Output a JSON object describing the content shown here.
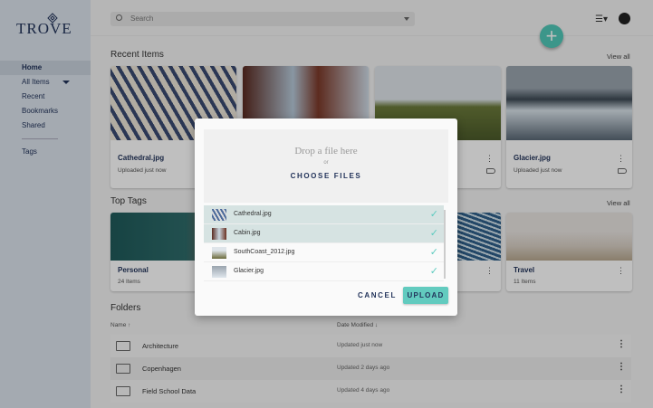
{
  "app": {
    "logo": "TROVE"
  },
  "sidebar": {
    "items": [
      {
        "label": "Home",
        "active": true
      },
      {
        "label": "All Items"
      },
      {
        "label": "Recent"
      },
      {
        "label": "Bookmarks"
      },
      {
        "label": "Shared"
      },
      {
        "label": "Tags"
      }
    ]
  },
  "topbar": {
    "search_placeholder": "Search",
    "icons": [
      "search-icon",
      "list-view-icon",
      "account-icon",
      "add-icon"
    ]
  },
  "recent": {
    "title": "Recent Items",
    "view_all": "View all",
    "items": [
      {
        "title": "Cathedral.jpg",
        "subtitle": "Uploaded just now"
      },
      {
        "title": "",
        "subtitle": ""
      },
      {
        "title": "",
        "subtitle": ""
      },
      {
        "title": "Glacier.jpg",
        "subtitle": "Uploaded just now"
      }
    ]
  },
  "tags": {
    "title": "Top Tags",
    "view_all": "View all",
    "items": [
      {
        "title": "Personal",
        "subtitle": "24 Items"
      },
      {
        "title": "",
        "subtitle": ""
      },
      {
        "title": "",
        "subtitle": ""
      },
      {
        "title": "Travel",
        "subtitle": "11 Items"
      }
    ]
  },
  "folders": {
    "title": "Folders",
    "col_name": "Name ↑",
    "col_date": "Date Modified ↓",
    "rows": [
      {
        "name": "Architecture",
        "date": "Updated just now"
      },
      {
        "name": "Copenhagen",
        "date": "Updated 2 days ago"
      },
      {
        "name": "Field School Data",
        "date": "Updated 4 days ago"
      }
    ]
  },
  "modal": {
    "drop_text": "Drop a file here",
    "or": "or",
    "choose": "CHOOSE FILES",
    "files": [
      {
        "name": "Cathedral.jpg",
        "selected": true
      },
      {
        "name": "Cabin.jpg",
        "selected": true
      },
      {
        "name": "SouthCoast_2012.jpg",
        "selected": false
      },
      {
        "name": "Glacier.jpg",
        "selected": false
      }
    ],
    "check": "✓",
    "cancel": "CANCEL",
    "upload": "UPLOAD"
  },
  "colors": {
    "accent": "#62cbbf",
    "navy": "#22335a"
  }
}
